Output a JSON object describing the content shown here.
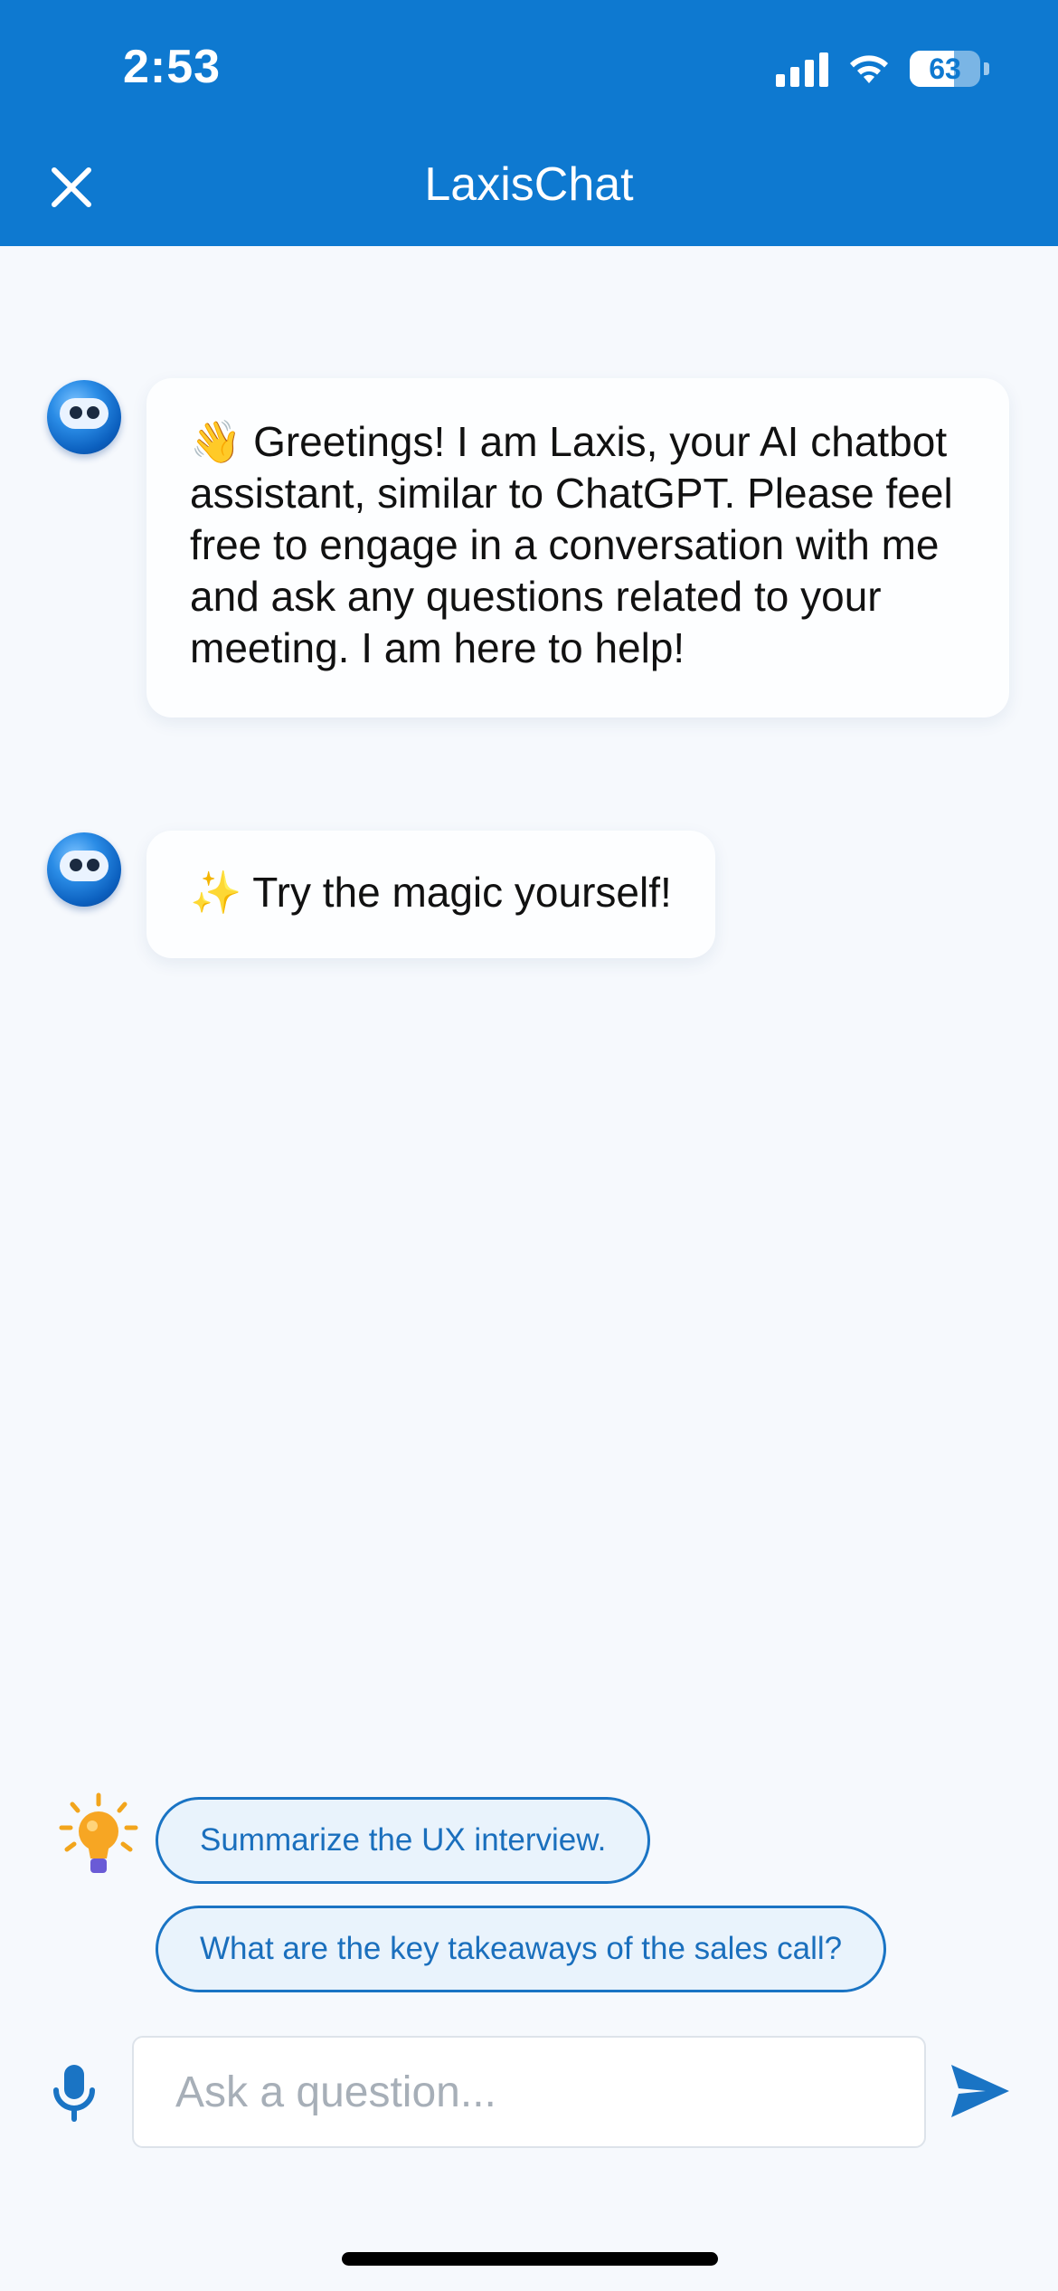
{
  "status_bar": {
    "time": "2:53",
    "battery": "63",
    "icons": [
      "cellular-signal-icon",
      "wifi-icon",
      "battery-icon"
    ]
  },
  "header": {
    "title": "LaxisChat",
    "close_icon": "close-icon",
    "background": "#0e79d0"
  },
  "messages": [
    {
      "sender": "bot",
      "emoji": "👋",
      "text": "Greetings! I am Laxis, your AI chatbot assistant, similar to ChatGPT. Please feel free to engage in a conversation with me and ask any questions related to your meeting. I am here to help!"
    },
    {
      "sender": "bot",
      "emoji": "✨",
      "text": "Try the magic yourself!"
    }
  ],
  "suggestions": {
    "icon": "lightbulb-icon",
    "items": [
      "Summarize the UX interview.",
      "What are the key takeaways of the sales call?"
    ]
  },
  "composer": {
    "placeholder": "Ask a question...",
    "mic_icon": "microphone-icon",
    "send_icon": "send-icon",
    "accent": "#1a74c4"
  }
}
